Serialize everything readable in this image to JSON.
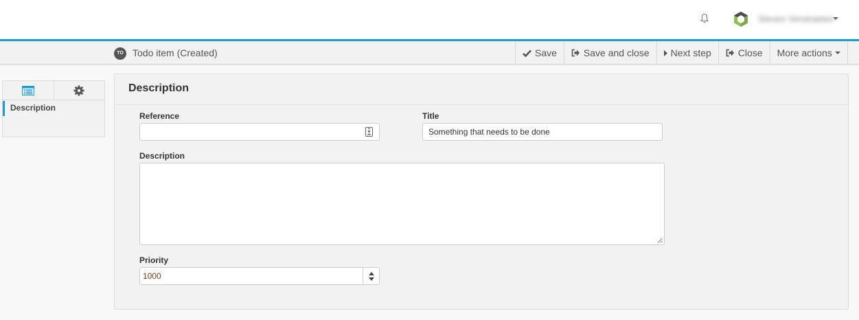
{
  "header": {
    "user_name": "Steven Verstraeten",
    "icons": {
      "notifications": "bell-icon",
      "app_logo": "hexagon-logo",
      "user_menu": "chevron-down-icon"
    }
  },
  "colors": {
    "accent": "#1a9ad7",
    "toolbar_bg": "#f2f2f2",
    "panel_bg": "#f2f2f2"
  },
  "toolbar": {
    "entity_badge": "TO",
    "entity_title": "Todo item (Created)",
    "actions": {
      "save": "Save",
      "save_and_close": "Save and close",
      "next_step": "Next step",
      "close": "Close",
      "more_actions": "More actions"
    }
  },
  "sidebar": {
    "tabs": [
      {
        "icon": "list-icon",
        "active": true
      },
      {
        "icon": "gear-icon",
        "active": false
      }
    ],
    "items": [
      {
        "label": "Description",
        "active": true
      }
    ]
  },
  "form": {
    "section_title": "Description",
    "reference": {
      "label": "Reference",
      "value": ""
    },
    "title": {
      "label": "Title",
      "value": "Something that needs to be done"
    },
    "description": {
      "label": "Description",
      "value": ""
    },
    "priority": {
      "label": "Priority",
      "value": "1000"
    }
  }
}
